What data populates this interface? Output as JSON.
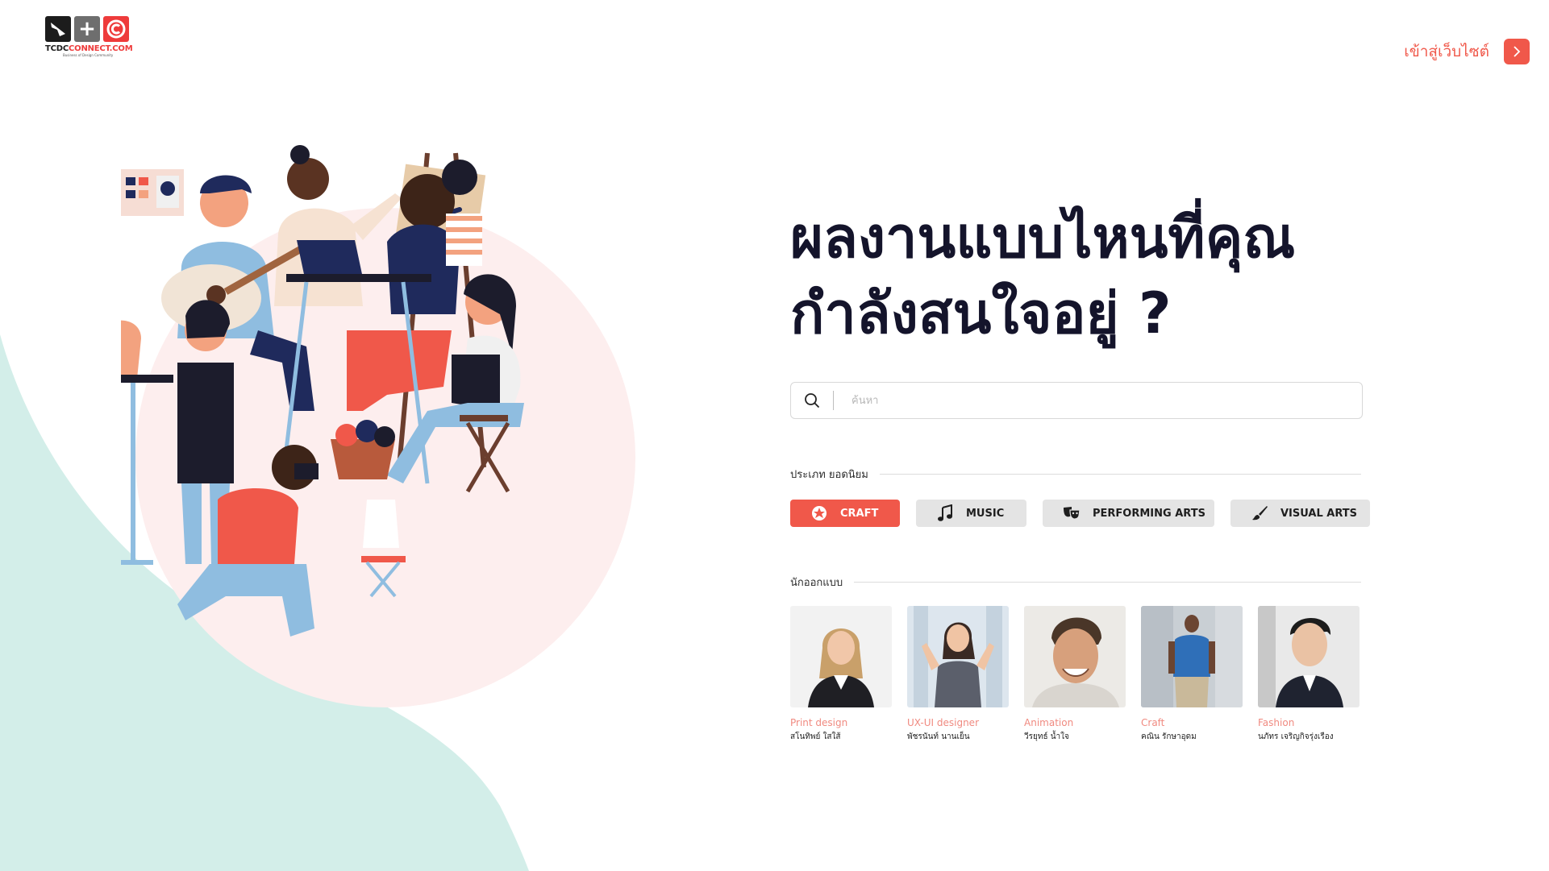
{
  "colors": {
    "accent": "#f0584a",
    "mint": "#d3eee9",
    "pink": "#fdeeee",
    "navy": "#1f2a5c"
  },
  "header": {
    "logo_text_a": "TCDC",
    "logo_text_b": "CONNECT.COM",
    "logo_sub": "Business of Design Community",
    "top_link": "เข้าสู่เว็บไซต์"
  },
  "hero": {
    "line1": "ผลงานแบบไหนที่คุณ",
    "line2": "กำลังสนใจอยู่ ?"
  },
  "search": {
    "placeholder": "ค้นหา",
    "value": ""
  },
  "categories": {
    "title": "ประเภท ยอดนิยม",
    "items": [
      {
        "label": "CRAFT",
        "icon": "craft-badge-icon",
        "active": true
      },
      {
        "label": "MUSIC",
        "icon": "music-note-icon",
        "active": false
      },
      {
        "label": "PERFORMING ARTS",
        "icon": "theater-masks-icon",
        "active": false
      },
      {
        "label": "VISUAL ARTS",
        "icon": "paint-brush-icon",
        "active": false
      }
    ]
  },
  "designers": {
    "title": "นักออกแบบ",
    "items": [
      {
        "role": "Print design",
        "name": "สโนทิพย์ ใสใส้"
      },
      {
        "role": "UX-UI designer",
        "name": "พัชรนันท์ นานเย็น"
      },
      {
        "role": "Animation",
        "name": "วีรยุทธ์ น้ำใจ"
      },
      {
        "role": "Craft",
        "name": "คณิน รักษาอุดม"
      },
      {
        "role": "Fashion",
        "name": "นภัทร เจริญกิจรุ่งเรือง"
      }
    ]
  }
}
